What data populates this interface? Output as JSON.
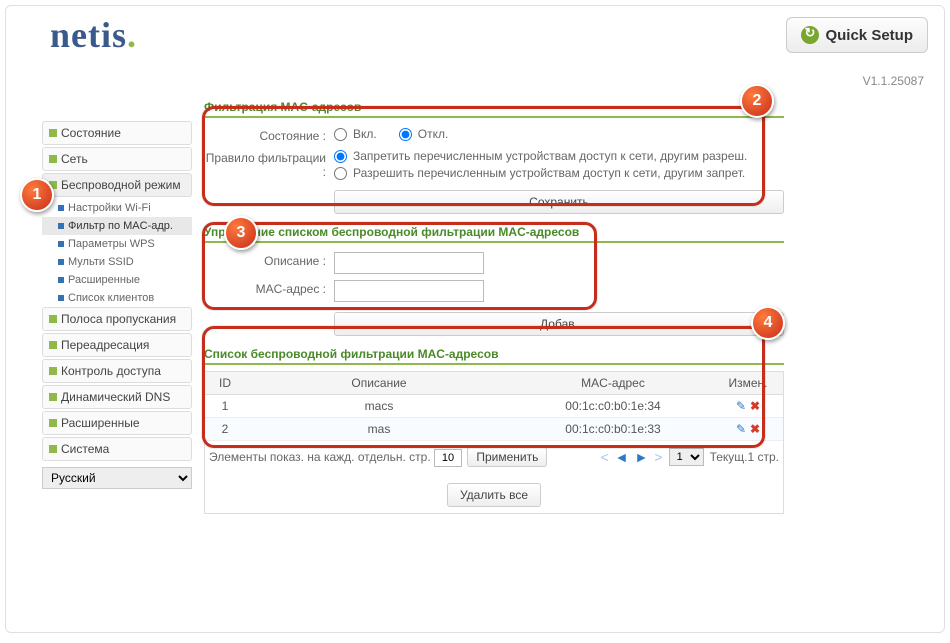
{
  "header": {
    "logo": "netis",
    "quick_setup": "Quick Setup",
    "version": "V1.1.25087"
  },
  "sidebar": {
    "items": [
      "Состояние",
      "Сеть",
      "Беспроводной режим",
      "Полоса пропускания",
      "Переадресация",
      "Контроль доступа",
      "Динамический DNS",
      "Расширенные",
      "Система"
    ],
    "sub": [
      "Настройки Wi-Fi",
      "Фильтр по MAC-адр.",
      "Параметры WPS",
      "Мульти SSID",
      "Расширенные",
      "Список клиентов"
    ],
    "language": "Русский"
  },
  "sections": {
    "filter_title": "Фильтрация MAC-адресов",
    "manage_title": "Управление списком беспроводной фильтрации MAC-адресов",
    "list_title": "Список беспроводной фильтрации MAC-адресов"
  },
  "form": {
    "state_label": "Состояние :",
    "state_on": "Вкл.",
    "state_off": "Откл.",
    "rule_label": "Правило фильтрации :",
    "rule_deny": "Запретить перечисленным устройствам доступ к сети, другим разреш.",
    "rule_allow": "Разрешить перечисленным устройствам доступ к сети, другим запрет.",
    "save_btn": "Сохранить",
    "desc_label": "Описание :",
    "mac_label": "MAC-адрес :",
    "add_btn": "Добав."
  },
  "table": {
    "headers": {
      "id": "ID",
      "desc": "Описание",
      "mac": "MAC-адрес",
      "act": "Измен."
    },
    "rows": [
      {
        "id": "1",
        "desc": "macs",
        "mac": "00:1c:c0:b0:1e:34"
      },
      {
        "id": "2",
        "desc": "mas",
        "mac": "00:1c:c0:b0:1e:33"
      }
    ],
    "pager_text": "Элементы показ. на кажд. отдельн. стр.",
    "per_page": "10",
    "apply_btn": "Применить",
    "page_sel": "1",
    "current_text": "Текущ.1 стр.",
    "delete_all": "Удалить все"
  },
  "badges": {
    "b1": "1",
    "b2": "2",
    "b3": "3",
    "b4": "4"
  }
}
